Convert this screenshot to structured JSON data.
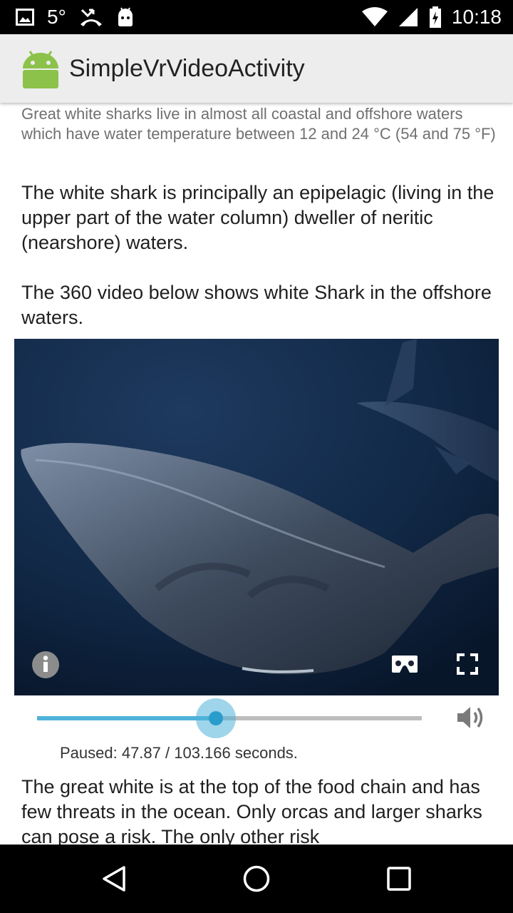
{
  "status_bar": {
    "temperature": "5°",
    "time": "10:18",
    "icons": [
      "image-icon",
      "missed-call-icon",
      "android-icon",
      "wifi-icon",
      "cell-signal-icon",
      "battery-icon"
    ]
  },
  "app_bar": {
    "title": "SimpleVrVideoActivity",
    "logo_icon": "android-logo-icon"
  },
  "content": {
    "paragraph_small": "Great white sharks live in almost all coastal and offshore waters which have water temperature between 12 and 24 °C (54 and 75 °F)",
    "paragraph_1": "The white shark is principally an epipelagic (living in the upper part of the water column) dweller of neritic (nearshore) waters.",
    "paragraph_2": "The 360 video below shows white Shark in the offshore waters.",
    "paragraph_3": "The great white is at the top of the food chain and has few threats in the ocean. Only orcas and larger sharks can pose a risk. The only other risk"
  },
  "video": {
    "info_icon": "info-icon",
    "cardboard_icon": "vr-cardboard-icon",
    "fullscreen_icon": "fullscreen-icon"
  },
  "player": {
    "progress_fraction": 0.464,
    "status_text": "Paused: 47.87 / 103.166 seconds.",
    "volume_icon": "volume-icon",
    "accent_color": "#4fb3d9"
  },
  "nav_bar": {
    "icons": [
      "back-icon",
      "home-icon",
      "recents-icon"
    ]
  }
}
